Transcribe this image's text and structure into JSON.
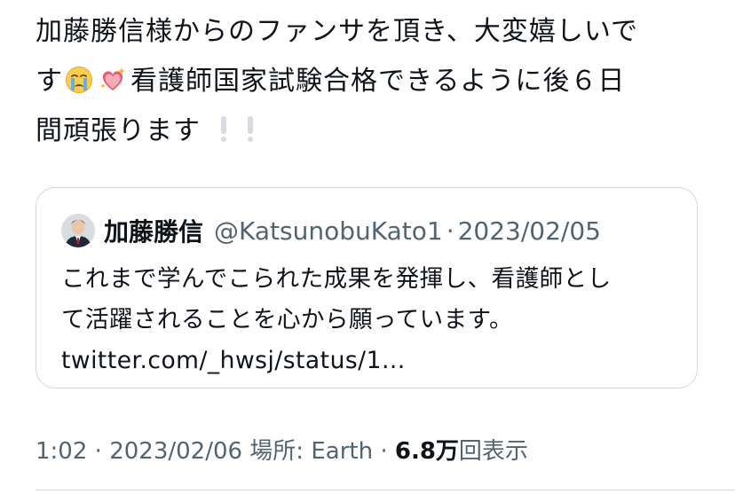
{
  "tweet": {
    "line1": "加藤勝信様からのファンサを頂き、大変嬉しいで",
    "line2_start": "す",
    "line2_after_emoji": "看護師国家試験合格できるように後６日",
    "line3": "間頑張ります",
    "emojis": [
      "loudly-crying-face-emoji",
      "sparkling-heart-emoji",
      "white-exclamation-mark-emoji",
      "white-exclamation-mark-emoji"
    ]
  },
  "quote": {
    "name": "加藤勝信",
    "handle": "@KatsunobuKato1",
    "separator": "·",
    "date": "2023/02/05",
    "text_line1": "これまで学んでこられた成果を発揮し、看護師とし",
    "text_line2": "て活躍されることを心から願っています。",
    "link": "twitter.com/_hwsj/status/1..."
  },
  "meta": {
    "time": "1:02",
    "sep1": " · ",
    "date": "2023/02/06",
    "location": " 場所: Earth",
    "sep2": " · ",
    "views_count": "6.8万",
    "views_label": "回表示"
  },
  "colors": {
    "text": "#0f1419",
    "secondary": "#536471",
    "border": "#cfd9de"
  }
}
